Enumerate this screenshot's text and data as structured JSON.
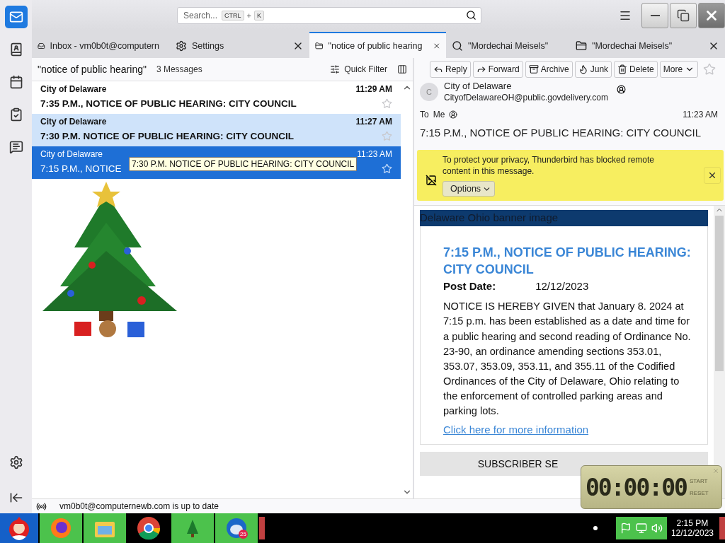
{
  "spaces": {
    "items": [
      {
        "kind": "mail",
        "selected": true
      },
      {
        "kind": "contacts",
        "selected": false
      },
      {
        "kind": "calendar",
        "selected": false
      },
      {
        "kind": "tasks",
        "selected": false
      },
      {
        "kind": "chat",
        "selected": false
      }
    ],
    "bottom": [
      {
        "kind": "settings"
      },
      {
        "kind": "collapse"
      }
    ]
  },
  "search": {
    "placeholder": "Search...",
    "keys": [
      "CTRL",
      "+",
      "K"
    ]
  },
  "tabs": [
    {
      "kind": "inbox",
      "label": "Inbox - vm0b0t@computern",
      "selected": false,
      "closable": false
    },
    {
      "kind": "settings",
      "label": "Settings",
      "selected": false,
      "closable": true
    },
    {
      "kind": "folder",
      "label": "\"notice of public hearing",
      "selected": true,
      "closable": true
    },
    {
      "kind": "search",
      "label": "\"Mordechai Meisels\"",
      "selected": false,
      "closable": false
    },
    {
      "kind": "folder",
      "label": "\"Mordechai Meisels\"",
      "selected": false,
      "closable": true
    }
  ],
  "list": {
    "title": "\"notice of public hearing\"",
    "count": "3 Messages",
    "quick_filter": "Quick Filter",
    "messages": [
      {
        "sender": "City of Delaware",
        "subject": "7:35 P.M., NOTICE OF PUBLIC HEARING: CITY COUNCIL",
        "time": "11:29 AM",
        "unread": true,
        "highlighted": false,
        "selected": false,
        "starred": false
      },
      {
        "sender": "City of Delaware",
        "subject": "7:30 P.M. NOTICE OF PUBLIC HEARING: CITY COUNCIL",
        "time": "11:27 AM",
        "unread": true,
        "highlighted": true,
        "selected": false,
        "starred": false
      },
      {
        "sender": "City of Delaware",
        "subject": "7:15 P.M., NOTICE",
        "time": "11:23 AM",
        "unread": false,
        "highlighted": false,
        "selected": true,
        "starred": false
      }
    ]
  },
  "tooltip": "7:30 P.M. NOTICE OF PUBLIC HEARING: CITY COUNCIL",
  "reader": {
    "actions": [
      {
        "kind": "reply",
        "label": "Reply"
      },
      {
        "kind": "forward",
        "label": "Forward"
      },
      {
        "kind": "archive",
        "label": "Archive"
      },
      {
        "kind": "junk",
        "label": "Junk"
      },
      {
        "kind": "delete",
        "label": "Delete"
      },
      {
        "kind": "more",
        "label": "More"
      }
    ],
    "starred": false,
    "sender": {
      "initial": "C",
      "name": "City of Delaware",
      "email": "CityofDelawareOH@public.govdelivery.com"
    },
    "to_label": "To",
    "recipient": "Me",
    "time": "11:23 AM",
    "subject": "7:15 P.M., NOTICE OF PUBLIC HEARING: CITY COUNCIL",
    "notice": {
      "text": "To protect your privacy, Thunderbird has blocked remote content in this message.",
      "button": "Options"
    },
    "body": {
      "banner": "Delaware Ohio banner image",
      "title": "7:15 P.M., NOTICE OF PUBLIC HEARING: CITY COUNCIL",
      "post_date_label": "Post Date:",
      "post_date": "12/12/2023",
      "paragraph": "NOTICE IS HEREBY GIVEN that January 8. 2024 at 7:15 p.m. has been established as a date and time for a public hearing and second reading of Ordinance No. 23-90, an ordinance amending sections 353.01, 353.07, 353.09, 353.11, and 355.11 of the Codified Ordinances of the City of Delaware, Ohio relating to the enforcement of controlled parking areas and parking lots.",
      "link": "Click here for more information",
      "footer": "SUBSCRIBER SE"
    }
  },
  "status": "vm0b0t@computernewb.com is up to date",
  "timer": {
    "display": "00:00:00",
    "buttons": [
      "START",
      "RESET"
    ]
  },
  "taskbar": {
    "apps": [
      {
        "kind": "firefox",
        "highlighted": true
      },
      {
        "kind": "explorer",
        "highlighted": true
      },
      {
        "kind": "chrome",
        "highlighted": false
      },
      {
        "kind": "tree",
        "highlighted": true
      },
      {
        "kind": "thunderbird",
        "highlighted": true,
        "badge": "25"
      }
    ],
    "time": "2:15 PM",
    "date": "12/12/2023"
  }
}
